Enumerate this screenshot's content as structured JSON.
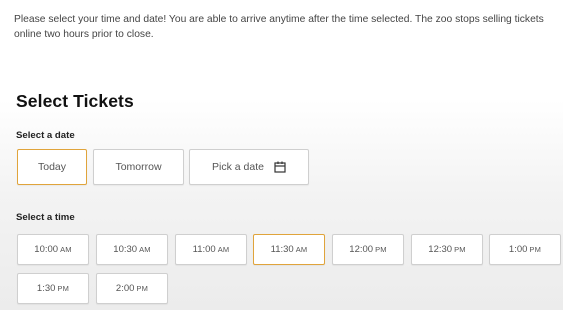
{
  "intro_text": "Please select your time and date! You are able to arrive anytime after the time selected. The zoo stops selling tickets online two hours prior to close.",
  "section_title": "Select Tickets",
  "date_section": {
    "label": "Select a date",
    "options": [
      "Today",
      "Tomorrow",
      "Pick a date"
    ],
    "selected": "Today",
    "pick_icon": "calendar-icon"
  },
  "time_section": {
    "label": "Select a time",
    "slots": [
      {
        "time": "10:00",
        "period": "AM"
      },
      {
        "time": "10:30",
        "period": "AM"
      },
      {
        "time": "11:00",
        "period": "AM"
      },
      {
        "time": "11:30",
        "period": "AM"
      },
      {
        "time": "12:00",
        "period": "PM"
      },
      {
        "time": "12:30",
        "period": "PM"
      },
      {
        "time": "1:00",
        "period": "PM"
      },
      {
        "time": "1:30",
        "period": "PM"
      },
      {
        "time": "2:00",
        "period": "PM"
      }
    ],
    "selected": "11:30 AM"
  },
  "colors": {
    "selected_border": "#e0a43b",
    "button_border": "#cfcfcf",
    "text": "#555555"
  }
}
